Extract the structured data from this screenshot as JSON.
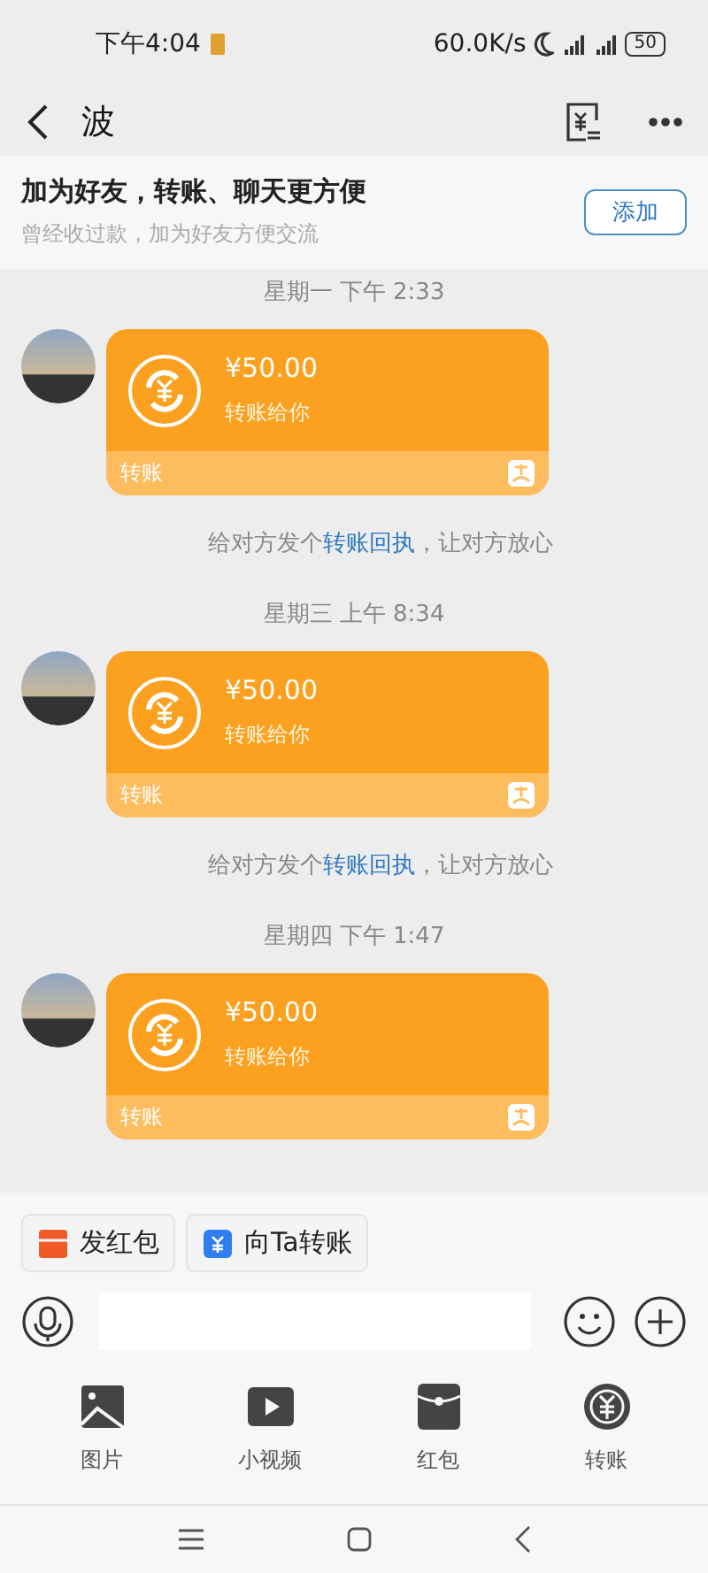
{
  "status_bar": {
    "time": "下午4:04",
    "speed": "60.0K/s",
    "battery": "50"
  },
  "header": {
    "title": "波"
  },
  "banner": {
    "title": "加为好友，转账、聊天更方便",
    "subtitle": "曾经收过款，加为好友方便交流",
    "button": "添加"
  },
  "messages": [
    {
      "timestamp": "星期一 下午 2:33",
      "amount": "¥50.00",
      "note": "转账给你",
      "label": "转账",
      "hint_before": "给对方发个",
      "hint_link": "转账回执",
      "hint_after": "，让对方放心"
    },
    {
      "timestamp": "星期三 上午 8:34",
      "amount": "¥50.00",
      "note": "转账给你",
      "label": "转账",
      "hint_before": "给对方发个",
      "hint_link": "转账回执",
      "hint_after": "，让对方放心"
    },
    {
      "timestamp": "星期四 下午 1:47",
      "amount": "¥50.00",
      "note": "转账给你",
      "label": "转账"
    }
  ],
  "quick_actions": [
    {
      "kind": "red_packet",
      "label": "发红包"
    },
    {
      "kind": "transfer",
      "label": "向Ta转账"
    }
  ],
  "tools": [
    {
      "kind": "image",
      "label": "图片"
    },
    {
      "kind": "video",
      "label": "小视频"
    },
    {
      "kind": "red_packet",
      "label": "红包"
    },
    {
      "kind": "transfer",
      "label": "转账"
    }
  ]
}
